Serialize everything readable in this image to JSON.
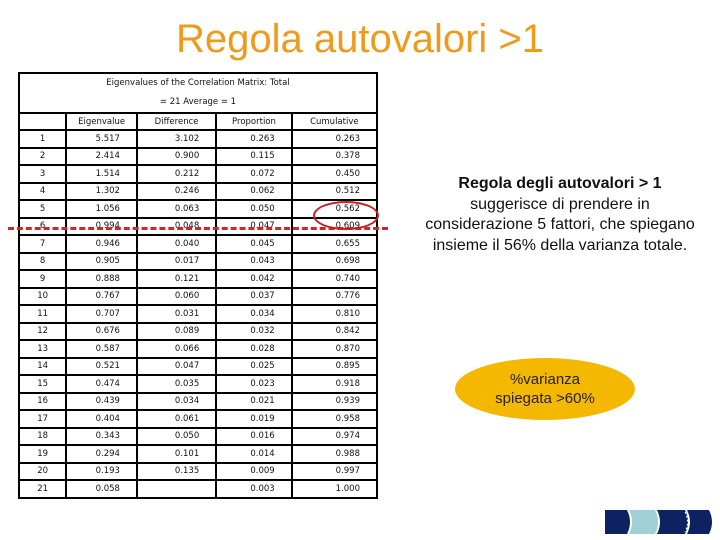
{
  "title": "Regola autovalori >1",
  "table": {
    "caption_line1": "Eigenvalues of the Correlation Matrix: Total",
    "caption_line2": "= 21 Average = 1",
    "headers": [
      "",
      "Eigenvalue",
      "Difference",
      "Proportion",
      "Cumulative"
    ],
    "rows": [
      [
        "1",
        "5.517",
        "3.102",
        "0.263",
        "0.263"
      ],
      [
        "2",
        "2.414",
        "0.900",
        "0.115",
        "0.378"
      ],
      [
        "3",
        "1.514",
        "0.212",
        "0.072",
        "0.450"
      ],
      [
        "4",
        "1.302",
        "0.246",
        "0.062",
        "0.512"
      ],
      [
        "5",
        "1.056",
        "0.063",
        "0.050",
        "0.562"
      ],
      [
        "6",
        "0.994",
        "0.048",
        "0.047",
        "0.609"
      ],
      [
        "7",
        "0.946",
        "0.040",
        "0.045",
        "0.655"
      ],
      [
        "8",
        "0.905",
        "0.017",
        "0.043",
        "0.698"
      ],
      [
        "9",
        "0.888",
        "0.121",
        "0.042",
        "0.740"
      ],
      [
        "10",
        "0.767",
        "0.060",
        "0.037",
        "0.776"
      ],
      [
        "11",
        "0.707",
        "0.031",
        "0.034",
        "0.810"
      ],
      [
        "12",
        "0.676",
        "0.089",
        "0.032",
        "0.842"
      ],
      [
        "13",
        "0.587",
        "0.066",
        "0.028",
        "0.870"
      ],
      [
        "14",
        "0.521",
        "0.047",
        "0.025",
        "0.895"
      ],
      [
        "15",
        "0.474",
        "0.035",
        "0.023",
        "0.918"
      ],
      [
        "16",
        "0.439",
        "0.034",
        "0.021",
        "0.939"
      ],
      [
        "17",
        "0.404",
        "0.061",
        "0.019",
        "0.958"
      ],
      [
        "18",
        "0.343",
        "0.050",
        "0.016",
        "0.974"
      ],
      [
        "19",
        "0.294",
        "0.101",
        "0.014",
        "0.988"
      ],
      [
        "20",
        "0.193",
        "0.135",
        "0.009",
        "0.997"
      ],
      [
        "21",
        "0.058",
        "",
        "0.003",
        "1.000"
      ]
    ]
  },
  "note": {
    "bold": "Regola degli autovalori > 1",
    "text": "suggerisce di prendere in considerazione 5 fattori, che spiegano insieme il 56% della varianza totale."
  },
  "badge": {
    "line1": "%varianza",
    "line2": "spiegata >60%"
  },
  "colors": {
    "title": "#ee9a1a",
    "highlight": "#c82020",
    "badge": "#f5b800",
    "nav_dark": "#0d2260",
    "nav_light": "#9fd0d6"
  },
  "nav": {
    "icon": "chevron-nav-arrows-icon"
  }
}
